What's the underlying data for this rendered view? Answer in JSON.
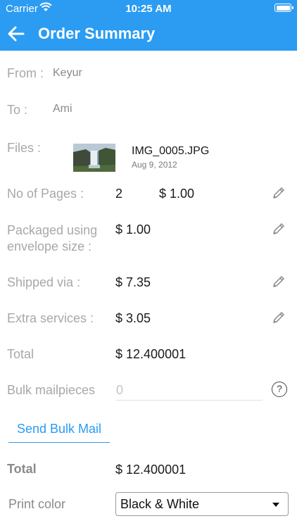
{
  "status_bar": {
    "carrier": "Carrier",
    "time": "10:25 AM"
  },
  "header": {
    "title": "Order Summary"
  },
  "icons": {
    "back": "arrow-left-icon",
    "edit": "pencil-icon",
    "help": "question-circle-icon",
    "wifi": "wifi-icon",
    "battery": "battery-icon",
    "dropdown": "caret-down-icon"
  },
  "colors": {
    "accent": "#2b9cf2",
    "label": "#a8a8a8",
    "value": "#1a1a1a"
  },
  "order": {
    "from_label": "From :",
    "from_value": "Keyur",
    "to_label": "To :",
    "to_value": "Ami",
    "files_label": "Files :",
    "file": {
      "name": "IMG_0005.JPG",
      "date": "Aug 9, 2012"
    },
    "pages_label": "No of Pages :",
    "pages_count": "2",
    "pages_price": "$ 1.00",
    "packaged_label_line1": "Packaged using",
    "packaged_label_line2": "envelope size :",
    "packaged_price": "$ 1.00",
    "shipped_label": "Shipped via :",
    "shipped_price": "$ 7.35",
    "extra_label": "Extra services :",
    "extra_price": "$ 3.05",
    "total_label": "Total",
    "total_value": "$ 12.400001",
    "bulk_label": "Bulk mailpieces",
    "bulk_placeholder": "0",
    "help_symbol": "?"
  },
  "actions": {
    "send_bulk_mail": "Send Bulk Mail"
  },
  "summary": {
    "total_label": "Total",
    "total_value": "$ 12.400001",
    "print_color_label": "Print color",
    "print_color_value": "Black & White"
  }
}
